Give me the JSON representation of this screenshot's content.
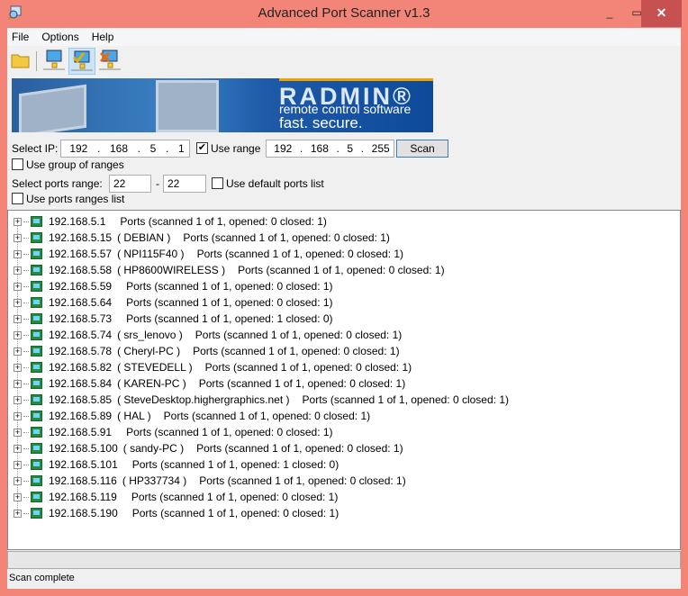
{
  "window": {
    "title": "Advanced Port Scanner v1.3",
    "minimize": "_",
    "maximize": "▭",
    "close": "✕"
  },
  "menu": [
    "File",
    "Options",
    "Help"
  ],
  "toolbar": [
    {
      "icon": "open-folder-icon"
    },
    {
      "icon": "computer-network-icon"
    },
    {
      "icon": "computer-check-icon",
      "active": true
    },
    {
      "icon": "computer-remove-icon"
    }
  ],
  "banner": {
    "brand": "RADMIN®",
    "line1": "remote control software",
    "line2": "fast. secure. affordable."
  },
  "ip": {
    "label": "Select IP:",
    "from": [
      "192",
      "168",
      "5",
      "1"
    ],
    "use_range_label": "Use range",
    "use_range_checked": true,
    "to": [
      "192",
      "168",
      "5",
      "255"
    ],
    "scan_label": "Scan",
    "group_label": "Use group of ranges",
    "group_checked": false
  },
  "ports": {
    "label": "Select ports range:",
    "from": "22",
    "dash": "-",
    "to": "22",
    "default_label": "Use default ports list",
    "default_checked": false,
    "ranges_label": "Use ports ranges list",
    "ranges_checked": false
  },
  "results": [
    {
      "ip": "192.168.5.1",
      "host": "",
      "ports": "Ports (scanned 1 of 1, opened: 0 closed: 1)"
    },
    {
      "ip": "192.168.5.15",
      "host": "( DEBIAN )",
      "ports": "Ports (scanned 1 of 1, opened: 0 closed: 1)"
    },
    {
      "ip": "192.168.5.57",
      "host": "( NPI115F40 )",
      "ports": "Ports (scanned 1 of 1, opened: 0 closed: 1)"
    },
    {
      "ip": "192.168.5.58",
      "host": "( HP8600WIRELESS )",
      "ports": "Ports (scanned 1 of 1, opened: 0 closed: 1)"
    },
    {
      "ip": "192.168.5.59",
      "host": "",
      "ports": "Ports (scanned 1 of 1, opened: 0 closed: 1)"
    },
    {
      "ip": "192.168.5.64",
      "host": "",
      "ports": "Ports (scanned 1 of 1, opened: 0 closed: 1)"
    },
    {
      "ip": "192.168.5.73",
      "host": "",
      "ports": "Ports (scanned 1 of 1, opened: 1 closed: 0)"
    },
    {
      "ip": "192.168.5.74",
      "host": "( srs_lenovo )",
      "ports": "Ports (scanned 1 of 1, opened: 0 closed: 1)"
    },
    {
      "ip": "192.168.5.78",
      "host": "( Cheryl-PC )",
      "ports": "Ports (scanned 1 of 1, opened: 0 closed: 1)"
    },
    {
      "ip": "192.168.5.82",
      "host": "( STEVEDELL )",
      "ports": "Ports (scanned 1 of 1, opened: 0 closed: 1)"
    },
    {
      "ip": "192.168.5.84",
      "host": "( KAREN-PC )",
      "ports": "Ports (scanned 1 of 1, opened: 0 closed: 1)"
    },
    {
      "ip": "192.168.5.85",
      "host": "( SteveDesktop.highergraphics.net )",
      "ports": "Ports (scanned 1 of 1, opened: 0 closed: 1)"
    },
    {
      "ip": "192.168.5.89",
      "host": "( HAL )",
      "ports": "Ports (scanned 1 of 1, opened: 0 closed: 1)"
    },
    {
      "ip": "192.168.5.91",
      "host": "",
      "ports": "Ports (scanned 1 of 1, opened: 0 closed: 1)"
    },
    {
      "ip": "192.168.5.100",
      "host": "( sandy-PC )",
      "ports": "Ports (scanned 1 of 1, opened: 0 closed: 1)"
    },
    {
      "ip": "192.168.5.101",
      "host": "",
      "ports": "Ports (scanned 1 of 1, opened: 1 closed: 0)"
    },
    {
      "ip": "192.168.5.116",
      "host": "( HP337734 )",
      "ports": "Ports (scanned 1 of 1, opened: 0 closed: 1)"
    },
    {
      "ip": "192.168.5.119",
      "host": "",
      "ports": "Ports (scanned 1 of 1, opened: 0 closed: 1)"
    },
    {
      "ip": "192.168.5.190",
      "host": "",
      "ports": "Ports (scanned 1 of 1, opened: 0 closed: 1)"
    }
  ],
  "progress": 0,
  "status": "Scan complete",
  "colors": {
    "titlebar": "#f38478",
    "close": "#c75050",
    "banner": "#1f5aa8"
  }
}
